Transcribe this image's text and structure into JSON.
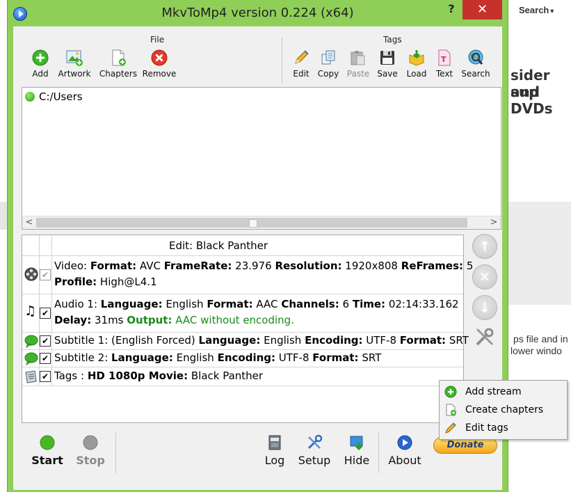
{
  "background": {
    "search_label": "Search",
    "fragment_1": "sider sup",
    "fragment_2": "and DVDs",
    "fragment_3": "ps file and in",
    "fragment_4": "lower windo"
  },
  "window": {
    "title": "MkvToMp4 version 0.224 (x64)",
    "help": "?",
    "close": "✕"
  },
  "ribbon": {
    "file_group": "File",
    "tags_group": "Tags",
    "file_tools": [
      {
        "label": "Add",
        "icon": "add-icon"
      },
      {
        "label": "Artwork",
        "icon": "artwork-icon"
      },
      {
        "label": "Chapters",
        "icon": "chapters-icon"
      },
      {
        "label": "Remove",
        "icon": "remove-icon"
      }
    ],
    "tag_tools": [
      {
        "label": "Edit",
        "icon": "pencil-icon"
      },
      {
        "label": "Copy",
        "icon": "copy-icon"
      },
      {
        "label": "Paste",
        "icon": "paste-icon",
        "disabled": true
      },
      {
        "label": "Save",
        "icon": "floppy-icon"
      },
      {
        "label": "Load",
        "icon": "load-icon"
      },
      {
        "label": "Text",
        "icon": "text-icon"
      },
      {
        "label": "Search",
        "icon": "search-globe-icon"
      }
    ]
  },
  "file_list": {
    "items": [
      {
        "path": "C:/Users"
      }
    ]
  },
  "streams": {
    "edit_label": "Edit: Black Panther",
    "video": {
      "prefix": "Video:",
      "k_format": "Format:",
      "v_format": "AVC",
      "k_framerate": "FrameRate:",
      "v_framerate": "23.976",
      "k_resolution": "Resolution:",
      "v_resolution": "1920x808",
      "k_reframes": "ReFrames:",
      "v_reframes": "5",
      "k_profile": "Profile:",
      "v_profile": "High@L4.1"
    },
    "audio": {
      "prefix": "Audio 1:",
      "k_language": "Language:",
      "v_language": "English",
      "k_format": "Format:",
      "v_format": "AAC",
      "k_channels": "Channels:",
      "v_channels": "6",
      "k_time": "Time:",
      "v_time": "02:14:33.162",
      "k_delay": "Delay:",
      "v_delay": "31ms",
      "k_output": "Output:",
      "v_output": "AAC without encoding."
    },
    "subtitle1": {
      "prefix": "Subtitle 1: (English Forced)",
      "k_language": "Language:",
      "v_language": "English",
      "k_encoding": "Encoding:",
      "v_encoding": "UTF-8",
      "k_format": "Format:",
      "v_format": "SRT"
    },
    "subtitle2": {
      "prefix": "Subtitle 2:",
      "k_language": "Language:",
      "v_language": "English",
      "k_encoding": "Encoding:",
      "v_encoding": "UTF-8",
      "k_format": "Format:",
      "v_format": "SRT"
    },
    "tags": {
      "prefix": "Tags :",
      "k_movie": "HD 1080p Movie:",
      "v_movie": "Black Panther"
    }
  },
  "bottom": {
    "start": "Start",
    "stop": "Stop",
    "log": "Log",
    "setup": "Setup",
    "hide": "Hide",
    "about": "About",
    "donate": "Donate"
  },
  "context_menu": {
    "items": [
      {
        "label": "Add stream",
        "icon": "add-icon"
      },
      {
        "label": "Create chapters",
        "icon": "chapters-icon"
      },
      {
        "label": "Edit tags",
        "icon": "pencil-icon"
      }
    ]
  }
}
